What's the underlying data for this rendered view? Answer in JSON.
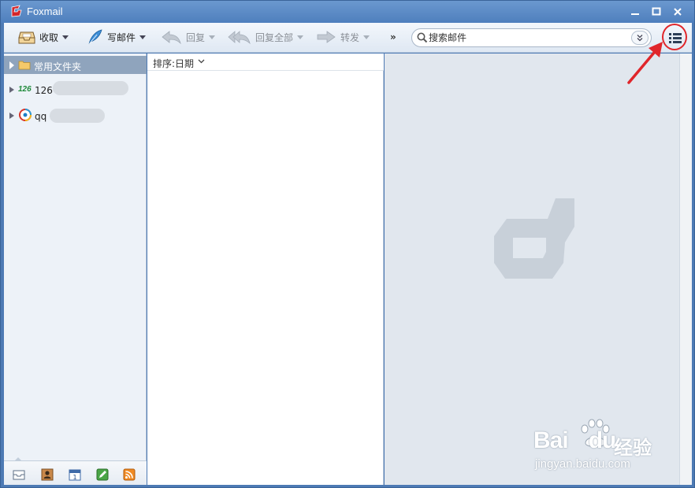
{
  "window": {
    "title": "Foxmail"
  },
  "toolbar": {
    "receive_label": "收取",
    "compose_label": "写邮件",
    "reply_label": "回复",
    "reply_all_label": "回复全部",
    "forward_label": "转发",
    "more_label": "»"
  },
  "search": {
    "placeholder": "搜索邮件"
  },
  "folders": {
    "common_label": "常用文件夹",
    "accounts": [
      {
        "label": "126",
        "badge": "126"
      },
      {
        "label": "qq"
      }
    ]
  },
  "list": {
    "sort_label": "排序:日期"
  },
  "watermark": {
    "brand": "Bai",
    "brand_tail": "du",
    "suffix": "经验",
    "url": "jingyan.baidu.com"
  },
  "colors": {
    "title_bar": "#5a8ac7",
    "folder_header": "#8fa4bd",
    "preview_bg": "#e1e7ee",
    "annotation": "#e0262b"
  },
  "icons": [
    "foxmail-logo-icon",
    "inbox-icon",
    "feather-pen-icon",
    "reply-icon",
    "reply-all-icon",
    "forward-icon",
    "search-icon",
    "chevron-double-down-icon",
    "menu-list-icon",
    "folder-icon",
    "mail-icon",
    "contacts-icon",
    "calendar-icon",
    "notes-icon",
    "rss-icon"
  ]
}
